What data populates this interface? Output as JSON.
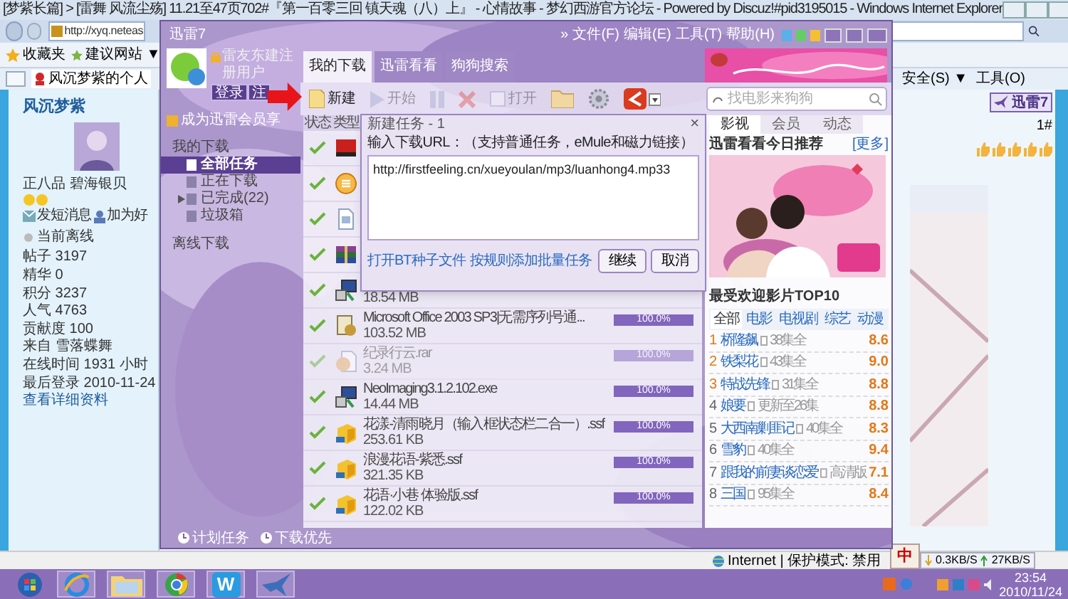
{
  "browser": {
    "title": "[梦紫长篇] > [雷舞 风流尘殇] 11.21至47页702#『第一百零三回 镇天魂（八）上』 - 心情故事 - 梦幻西游官方论坛 - Powered by Discuz!#pid3195015 - Windows Internet Explorer",
    "address": "http://xyq.neteas",
    "favorites": [
      "收藏夹",
      "建议网站 ▼"
    ],
    "tab": "风沉梦紫的个人",
    "commands": [
      "安全(S) ▼",
      "工具(O)"
    ],
    "status_zone": "Internet | 保护模式: 禁用"
  },
  "profile": {
    "name": "风沉梦紫",
    "rank": "正八品 碧海银贝",
    "actions": [
      "发短消息",
      "加为好"
    ],
    "presence": "当前离线",
    "stats": [
      {
        "label": "帖子",
        "value": "3197"
      },
      {
        "label": "精华",
        "value": "0"
      },
      {
        "label": "积分",
        "value": "3237"
      },
      {
        "label": "人气",
        "value": "4763"
      },
      {
        "label": "贡献度",
        "value": "100"
      },
      {
        "label": "来自",
        "value": "雪落蝶舞"
      },
      {
        "label": "在线时间",
        "value": "1931 小时"
      },
      {
        "label": "最后登录",
        "value": "2010-11-24"
      }
    ],
    "link": "查看详细资料"
  },
  "post": {
    "floor": "1#",
    "stars": 5
  },
  "badge": "迅雷7",
  "thunder": {
    "title": "迅雷7",
    "menu": [
      "»",
      "文件(F)",
      "编辑(E)",
      "工具(T)",
      "帮助(H)"
    ],
    "user": "雷友东建注册用户",
    "login_buttons": [
      "登录",
      "注"
    ],
    "vip": "成为迅雷会员享",
    "tree": [
      {
        "label": "我的下载",
        "selected": false,
        "children": [
          {
            "label": "全部任务",
            "selected": true
          },
          {
            "label": "正在下载",
            "selected": false
          },
          {
            "label": "已完成(22)",
            "selected": false,
            "expanded": false
          },
          {
            "label": "垃圾箱",
            "selected": false
          }
        ]
      },
      {
        "label": "离线下载",
        "selected": false
      }
    ],
    "tabs": [
      {
        "label": "我的下载",
        "selected": true
      },
      {
        "label": "迅雷看看",
        "selected": false
      },
      {
        "label": "狗狗搜索",
        "selected": false
      }
    ],
    "toolbar": [
      {
        "kind": "new",
        "label": "新建",
        "disabled": false
      },
      {
        "kind": "start",
        "label": "开始",
        "disabled": true
      },
      {
        "kind": "pause",
        "disabled": true
      },
      {
        "kind": "delete",
        "disabled": true
      },
      {
        "kind": "open",
        "label": "打开",
        "disabled": true
      },
      {
        "kind": "folder",
        "disabled": false
      },
      {
        "kind": "settings",
        "disabled": false
      },
      {
        "kind": "logo",
        "disabled": false
      }
    ],
    "search": {
      "placeholder": "找电影来狗狗"
    },
    "columns": [
      "状态",
      "类型"
    ],
    "tasks": [
      {
        "kind": "ati",
        "faded": false
      },
      {
        "kind": "disc",
        "faded": false
      },
      {
        "kind": "doc",
        "faded": false
      },
      {
        "kind": "archive",
        "faded": false
      },
      {
        "kind": "installer",
        "size": "18.54 MB",
        "faded": false
      },
      {
        "kind": "office",
        "name": "Microsoft Office 2003 SP3|无需序列号通...",
        "size": "103.52 MB",
        "level": 1,
        "reading": "100.0%",
        "faded": false
      },
      {
        "kind": "face",
        "name": "纪录行云.rar",
        "size": "3.24 MB",
        "level": 1,
        "reading": "100.0%",
        "faded": true
      },
      {
        "kind": "installer",
        "name": "NeoImaging3.1.2.102.exe",
        "size": "14.44 MB",
        "level": 1,
        "reading": "100.0%",
        "faded": false
      },
      {
        "kind": "ssf",
        "name": "花漾-清雨晓月（输入框状态栏二合一）.ssf",
        "size": "253.61 KB",
        "level": 1,
        "reading": "100.0%",
        "faded": false
      },
      {
        "kind": "ssf",
        "name": "浪漫花语-紫悉.ssf",
        "size": "321.35 KB",
        "level": 1,
        "reading": "100.0%",
        "faded": false
      },
      {
        "kind": "ssf",
        "name": "花语·小巷 体验版.ssf",
        "size": "122.02 KB",
        "level": 1,
        "reading": "100.0%",
        "faded": false
      }
    ],
    "footer": [
      "计划任务",
      "下载优先"
    ],
    "side_tabs": [
      {
        "label": "影视",
        "selected": true
      },
      {
        "label": "会员",
        "selected": false
      },
      {
        "label": "动态",
        "selected": false
      }
    ],
    "recommend": {
      "title": "迅雷看看今日推荐",
      "more": "[更多]"
    },
    "top_title": "最受欢迎影片TOP10",
    "categories": [
      {
        "label": "全部",
        "selected": true
      },
      {
        "label": "电影",
        "selected": false
      },
      {
        "label": "电视剧",
        "selected": false
      },
      {
        "label": "综艺",
        "selected": false
      },
      {
        "label": "动漫",
        "selected": false
      }
    ],
    "top": [
      {
        "rank": "1",
        "title": "桥隆飙",
        "note": "38集全",
        "score": "8.6",
        "hot": true
      },
      {
        "rank": "2",
        "title": "铁梨花",
        "note": "43集全",
        "score": "9.0",
        "hot": true
      },
      {
        "rank": "3",
        "title": "特战先锋",
        "note": "31集全",
        "score": "8.8",
        "hot": true
      },
      {
        "rank": "4",
        "title": "娘要",
        "note": "更新至26集",
        "score": "8.8",
        "hot": false
      },
      {
        "rank": "5",
        "title": "大西南剿匪记",
        "note": "40集全",
        "score": "8.3",
        "hot": false
      },
      {
        "rank": "6",
        "title": "雪豹",
        "note": "40集全",
        "score": "9.4",
        "hot": false
      },
      {
        "rank": "7",
        "title": "跟我的前妻谈恋爱",
        "note": "高清版",
        "score": "7.1",
        "hot": false
      },
      {
        "rank": "8",
        "title": "三国",
        "note": "95集全",
        "score": "8.4",
        "hot": false
      }
    ]
  },
  "dialog": {
    "title": "新建任务 - 1",
    "close": "×",
    "prompt": "输入下载URL：（支持普通任务，eMule和磁力链接）",
    "url": "http://firstfeeling.cn/xueyoulan/mp3/luanhong4.mp33",
    "links": [
      "打开BT种子文件",
      "按规则添加批量任务"
    ],
    "buttons": [
      "继续",
      "取消"
    ]
  },
  "ime": "中",
  "speed": {
    "down": "0.3KB/S",
    "up": "27KB/S"
  },
  "taskbar": {
    "apps": [
      {
        "kind": "ie"
      },
      {
        "kind": "folder"
      },
      {
        "kind": "chrome"
      },
      {
        "kind": "word",
        "label": "W"
      },
      {
        "kind": "bird"
      }
    ],
    "time": "23:54",
    "date": "2010/11/24"
  }
}
